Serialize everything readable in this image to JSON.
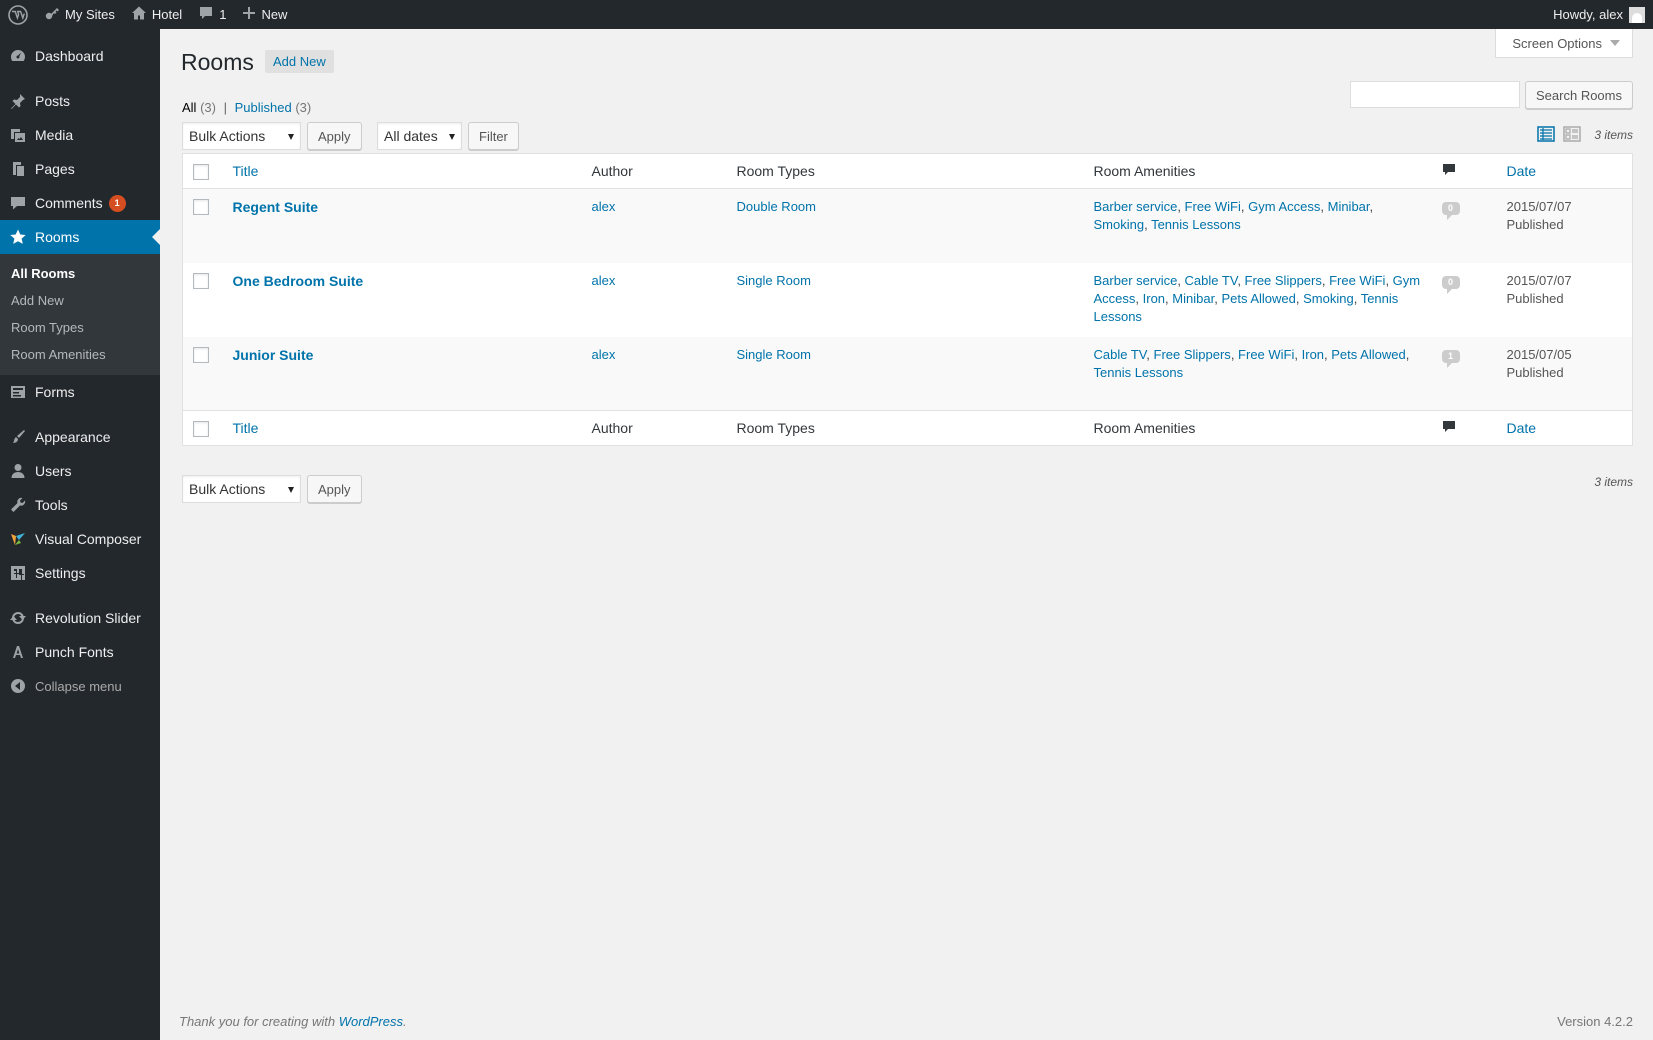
{
  "adminbar": {
    "my_sites": "My Sites",
    "site_name": "Hotel",
    "comments_count": "1",
    "new_label": "New",
    "howdy": "Howdy, alex"
  },
  "sidebar": {
    "items": [
      {
        "label": "Dashboard",
        "icon": "dashboard-icon"
      },
      {
        "label": "Posts",
        "icon": "pin-icon"
      },
      {
        "label": "Media",
        "icon": "media-icon"
      },
      {
        "label": "Pages",
        "icon": "pages-icon"
      },
      {
        "label": "Comments",
        "icon": "comment-icon",
        "badge": "1"
      },
      {
        "label": "Rooms",
        "icon": "star-icon"
      },
      {
        "label": "Forms",
        "icon": "forms-icon"
      },
      {
        "label": "Appearance",
        "icon": "brush-icon"
      },
      {
        "label": "Users",
        "icon": "user-icon"
      },
      {
        "label": "Tools",
        "icon": "wrench-icon"
      },
      {
        "label": "Visual Composer",
        "icon": "visual-composer-icon"
      },
      {
        "label": "Settings",
        "icon": "settings-icon"
      },
      {
        "label": "Revolution Slider",
        "icon": "refresh-icon"
      },
      {
        "label": "Punch Fonts",
        "icon": "font-icon"
      }
    ],
    "submenu": [
      "All Rooms",
      "Add New",
      "Room Types",
      "Room Amenities"
    ],
    "collapse": "Collapse menu"
  },
  "header": {
    "screen_options": "Screen Options",
    "title": "Rooms",
    "add_new": "Add New"
  },
  "filters": {
    "all": "All",
    "all_count": "(3)",
    "separator": "|",
    "published": "Published",
    "published_count": "(3)"
  },
  "search": {
    "button": "Search Rooms",
    "value": ""
  },
  "tablenav": {
    "bulk_actions": "Bulk Actions",
    "apply": "Apply",
    "all_dates": "All dates",
    "filter": "Filter",
    "items": "3 items"
  },
  "table": {
    "columns": {
      "title": "Title",
      "author": "Author",
      "room_types": "Room Types",
      "room_amenities": "Room Amenities",
      "date": "Date"
    },
    "rows": [
      {
        "title": "Regent Suite",
        "author": "alex",
        "room_type": "Double Room",
        "amenities": [
          "Barber service",
          "Free WiFi",
          "Gym Access",
          "Minibar",
          "Smoking",
          "Tennis Lessons"
        ],
        "comments": "0",
        "date": "2015/07/07",
        "status": "Published"
      },
      {
        "title": "One Bedroom Suite",
        "author": "alex",
        "room_type": "Single Room",
        "amenities": [
          "Barber service",
          "Cable TV",
          "Free Slippers",
          "Free WiFi",
          "Gym Access",
          "Iron",
          "Minibar",
          "Pets Allowed",
          "Smoking",
          "Tennis Lessons"
        ],
        "comments": "0",
        "date": "2015/07/07",
        "status": "Published"
      },
      {
        "title": "Junior Suite",
        "author": "alex",
        "room_type": "Single Room",
        "amenities": [
          "Cable TV",
          "Free Slippers",
          "Free WiFi",
          "Iron",
          "Pets Allowed",
          "Tennis Lessons"
        ],
        "comments": "1",
        "date": "2015/07/05",
        "status": "Published"
      }
    ]
  },
  "footer": {
    "thanks_prefix": "Thank you for creating with ",
    "wordpress": "WordPress",
    "thanks_suffix": ".",
    "version": "Version 4.2.2"
  },
  "colors": {
    "admin_bar": "#23282d",
    "accent": "#0073aa",
    "badge": "#d54e21"
  }
}
